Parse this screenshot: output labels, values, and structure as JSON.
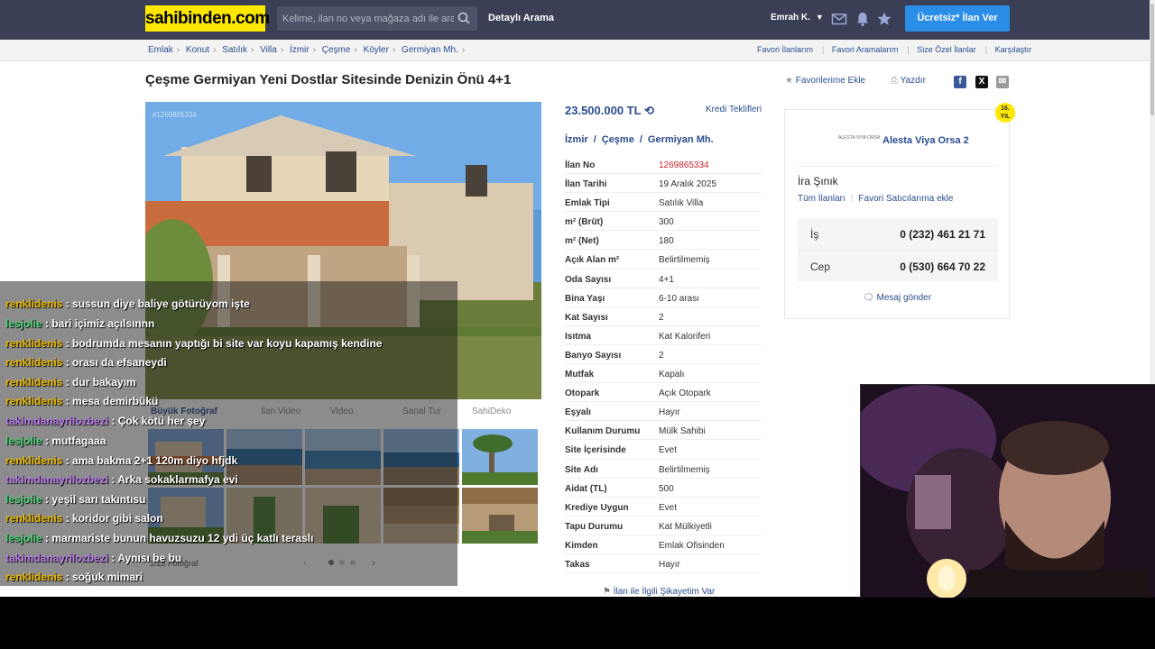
{
  "header": {
    "logo": "sahibinden.com",
    "search_placeholder": "Kelime, ilan no veya mağaza adı ile ara",
    "advanced_search": "Detaylı Arama",
    "user_name": "Emrah K.",
    "cta": "Ücretsiz* İlan Ver"
  },
  "breadcrumb": {
    "items": [
      "Emlak",
      "Konut",
      "Satılık",
      "Villa",
      "İzmir",
      "Çeşme",
      "Köyler",
      "Germiyan Mh."
    ],
    "right_links": [
      "Favori İlanlarım",
      "Favori Aramalarım",
      "Size Özel İlanlar",
      "Karşılaştır"
    ]
  },
  "listing": {
    "title": "Çeşme Germiyan Yeni Dostlar Sitesinde Denizin Önü 4+1",
    "favorite_label": "Favorilerime Ekle",
    "print_label": "Yazdır",
    "photo_watermark": "#1269865334",
    "photo_tabs": [
      "Büyük Fotoğraf",
      "İlan Video",
      "Video",
      "Sanal Tur",
      "SahiDeko"
    ],
    "photo_count": "1/28 Fotoğraf",
    "price": "23.500.000 TL",
    "credit_label": "Kredi Teklifleri",
    "location": [
      "İzmir",
      "Çeşme",
      "Germiyan Mh."
    ],
    "details": [
      {
        "k": "İlan No",
        "v": "1269865334"
      },
      {
        "k": "İlan Tarihi",
        "v": "19 Aralık 2025"
      },
      {
        "k": "Emlak Tipi",
        "v": "Satılık Villa"
      },
      {
        "k": "m² (Brüt)",
        "v": "300"
      },
      {
        "k": "m² (Net)",
        "v": "180"
      },
      {
        "k": "Açık Alan m²",
        "v": "Belirtilmemiş"
      },
      {
        "k": "Oda Sayısı",
        "v": "4+1"
      },
      {
        "k": "Bina Yaşı",
        "v": "6-10 arası"
      },
      {
        "k": "Kat Sayısı",
        "v": "2"
      },
      {
        "k": "Isıtma",
        "v": "Kat Kaloriferi"
      },
      {
        "k": "Banyo Sayısı",
        "v": "2"
      },
      {
        "k": "Mutfak",
        "v": "Kapalı"
      },
      {
        "k": "Otopark",
        "v": "Açık Otopark"
      },
      {
        "k": "Eşyalı",
        "v": "Hayır"
      },
      {
        "k": "Kullanım Durumu",
        "v": "Mülk Sahibi"
      },
      {
        "k": "Site İçerisinde",
        "v": "Evet"
      },
      {
        "k": "Site Adı",
        "v": "Belirtilmemiş"
      },
      {
        "k": "Aidat (TL)",
        "v": "500"
      },
      {
        "k": "Krediye Uygun",
        "v": "Evet"
      },
      {
        "k": "Tapu Durumu",
        "v": "Kat Mülkiyetli"
      },
      {
        "k": "Kimden",
        "v": "Emlak Ofisinden"
      },
      {
        "k": "Takas",
        "v": "Hayır"
      }
    ],
    "complaint": "İlan ile İlgili Şikayetim Var"
  },
  "seller": {
    "badge": "16. YIL",
    "logo_text": "ALESTA VIYA ORSA",
    "store_name": "Alesta Viya Orsa 2",
    "agent": "İra Şınık",
    "all_listings": "Tüm İlanları",
    "favorite_sellers": "Favori Satıcılarıma ekle",
    "phones": [
      {
        "label": "İş",
        "number": "0 (232) 461 21 71"
      },
      {
        "label": "Cep",
        "number": "0 (530) 664 70 22"
      }
    ],
    "message": "Mesaj gönder"
  },
  "chat": [
    {
      "nick": "renklidenis",
      "text": " : sussun diye baliye götürüyom işte",
      "color": "#e8b800"
    },
    {
      "nick": "lesjolie",
      "text": " : bari içimiz açılsınnn",
      "color": "#4dd37a"
    },
    {
      "nick": "renklidenis",
      "text": " : bodrumda mesanın yaptığı bi site var koyu kapamış kendine",
      "color": "#e8b800"
    },
    {
      "nick": "renklidenis",
      "text": " : orası da efsaneydi",
      "color": "#e8b800"
    },
    {
      "nick": "renklidenis",
      "text": " : dur bakayım",
      "color": "#e8b800"
    },
    {
      "nick": "renklidenis",
      "text": " : mesa demirbükü",
      "color": "#e8b800"
    },
    {
      "nick": "takimdanayrilozbezi",
      "text": " : Çok kötü her şey",
      "color": "#b57ce8"
    },
    {
      "nick": "lesjolie",
      "text": " : mutfagaaa",
      "color": "#4dd37a"
    },
    {
      "nick": "renklidenis",
      "text": " : ama bakma 2+1 120m diyo hfjdk",
      "color": "#e8b800"
    },
    {
      "nick": "takimdanayrilozbezi",
      "text": " : Arka sokaklarmafya evi",
      "color": "#b57ce8"
    },
    {
      "nick": "lesjolie",
      "text": " : yeşil sarı takıntısu",
      "color": "#4dd37a"
    },
    {
      "nick": "renklidenis",
      "text": " : koridor gibi salon",
      "color": "#e8b800"
    },
    {
      "nick": "lesjolie",
      "text": " : marmariste bunun havuzsuzu 12 ydi üç katlı teraslı",
      "color": "#4dd37a"
    },
    {
      "nick": "takimdanayrilozbezi",
      "text": " : Aynısı be bu",
      "color": "#b57ce8"
    },
    {
      "nick": "renklidenis",
      "text": " : soğuk mimari",
      "color": "#e8b800"
    }
  ],
  "colors": {
    "header_bg": "#3a3f56",
    "brand_yellow": "#ffe800",
    "link_blue": "#2a4d8f",
    "cta_blue": "#2a8ee8",
    "listing_no_red": "#c81e2c"
  }
}
